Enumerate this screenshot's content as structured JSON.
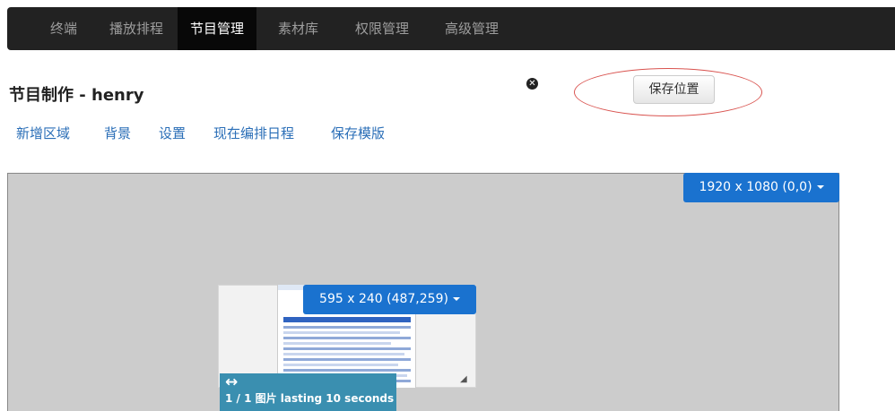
{
  "nav": {
    "items": [
      {
        "label": "终端"
      },
      {
        "label": "播放排程"
      },
      {
        "label": "节目管理",
        "active": true
      },
      {
        "label": "素材库"
      },
      {
        "label": "权限管理"
      },
      {
        "label": "高级管理"
      }
    ]
  },
  "page": {
    "title": "节目制作 - henry",
    "close_icon": "close-circle-icon",
    "save_position_label": "保存位置"
  },
  "actions": [
    "新增区域",
    "背景",
    "设置",
    "现在编排日程",
    "保存模版"
  ],
  "canvas": {
    "resolution_label": "1920 x 1080 (0,0)",
    "background_color": "#cccccc"
  },
  "region": {
    "size_label": "595 x 240 (487,259)",
    "move_icon": "↔",
    "info": "1 / 1 图片 lasting 10 seconds",
    "resize_icon": "resize-grip-icon"
  },
  "colors": {
    "navbar": "#222222",
    "link": "#2a6eb7",
    "primary_button": "#1a72cf",
    "info_box": "#3a8fb0",
    "highlight_ellipse": "#d9534f"
  }
}
